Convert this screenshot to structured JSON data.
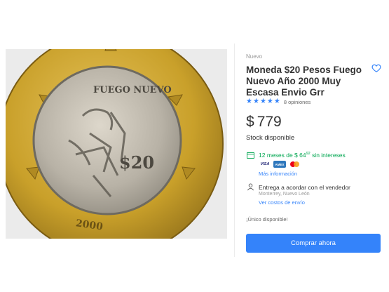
{
  "product": {
    "condition": "Nuevo",
    "title": "Moneda $20 Pesos Fuego Nuevo Año 2000 Muy Escasa Envio Grr",
    "rating": 5,
    "reviews": "8 opiniones",
    "currency": "$",
    "price": "779",
    "stock": "Stock disponible"
  },
  "payment": {
    "cuotas_prefix": "12 meses de $ 64",
    "cuotas_cents": "92",
    "cuotas_suffix": " sin intereses",
    "cards": [
      "VISA",
      "AMEX",
      "Mastercard"
    ],
    "more_info": "Más información"
  },
  "shipping": {
    "title": "Entrega a acordar con el vendedor",
    "location": "Monterrey, Nuevo León",
    "costs_link": "Ver costos de envío"
  },
  "availability": "¡Único disponible!",
  "buy_button": "Comprar ahora",
  "coin": {
    "top_text": "FUEGO NUEVO",
    "denomination": "$20",
    "year": "2000"
  },
  "colors": {
    "accent": "#3483fa",
    "green": "#00a650",
    "gold": "#c9a02a",
    "silver": "#b8b2a6"
  },
  "icons": {
    "favorite": "heart-icon",
    "payment": "card-icon",
    "shipping": "person-icon"
  }
}
